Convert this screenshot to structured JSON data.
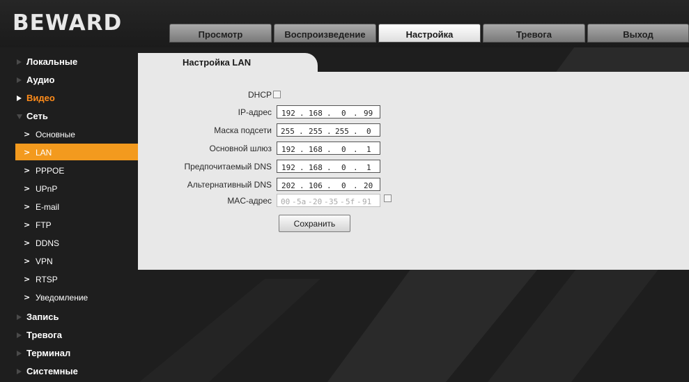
{
  "brand": "BEWARD",
  "tabs": [
    "Просмотр",
    "Воспроизведение",
    "Настройка",
    "Тревога",
    "Выход"
  ],
  "active_tab": "Настройка",
  "sidebar": {
    "top": [
      {
        "label": "Локальные",
        "state": "collapsed"
      },
      {
        "label": "Аудио",
        "state": "collapsed"
      },
      {
        "label": "Видео",
        "state": "highlighted"
      }
    ],
    "network": {
      "label": "Сеть",
      "state": "expanded"
    },
    "sub_items": [
      "Основные",
      "LAN",
      "PPPOE",
      "UPnP",
      "E-mail",
      "FTP",
      "DDNS",
      "VPN",
      "RTSP",
      "Уведомление"
    ],
    "selected_sub": "LAN",
    "bottom": [
      {
        "label": "Запись",
        "state": "collapsed"
      },
      {
        "label": "Тревога",
        "state": "collapsed"
      },
      {
        "label": "Терминал",
        "state": "collapsed"
      },
      {
        "label": "Системные",
        "state": "collapsed"
      }
    ]
  },
  "page_title": "Настройка LAN",
  "form": {
    "dhcp_label": "DHCP",
    "dhcp_checked": false,
    "ip_label": "IP-адрес",
    "ip": [
      "192",
      "168",
      "0",
      "99"
    ],
    "mask_label": "Маска подсети",
    "mask": [
      "255",
      "255",
      "255",
      "0"
    ],
    "gateway_label": "Основной шлюз",
    "gateway": [
      "192",
      "168",
      "0",
      "1"
    ],
    "dns1_label": "Предпочитаемый DNS",
    "dns1": [
      "192",
      "168",
      "0",
      "1"
    ],
    "dns2_label": "Альтернативный DNS",
    "dns2": [
      "202",
      "106",
      "0",
      "20"
    ],
    "mac_label": "MAC-адрес",
    "mac": [
      "00",
      "5a",
      "20",
      "35",
      "5f",
      "91"
    ],
    "mac_checked": false,
    "save_label": "Сохранить"
  },
  "colors": {
    "accent": "#f39a1e",
    "highlight_text": "#ff8c1a",
    "background": "#1e1e1e",
    "panel": "#e8e8e8"
  }
}
